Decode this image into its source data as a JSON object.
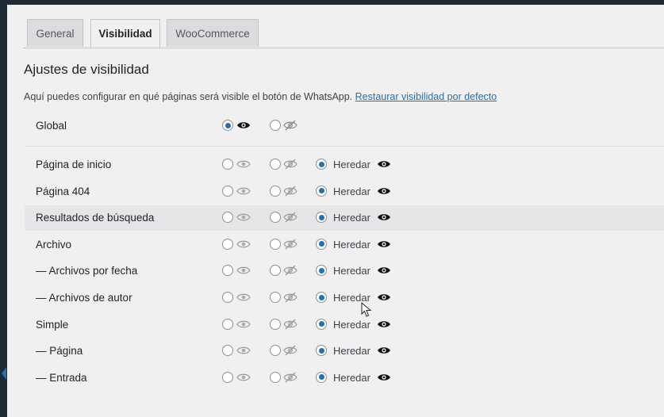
{
  "tabs": [
    {
      "label": "General",
      "active": false
    },
    {
      "label": "Visibilidad",
      "active": true
    },
    {
      "label": "WooCommerce",
      "active": false
    }
  ],
  "section": {
    "title": "Ajustes de visibilidad",
    "description": "Aquí puedes configurar en qué páginas será visible el botón de WhatsApp.",
    "restore_link": "Restaurar visibilidad por defecto"
  },
  "global": {
    "label": "Global",
    "selected": "show"
  },
  "rows": [
    {
      "label": "Página de inicio",
      "inherit": "Heredar",
      "selected": "inherit"
    },
    {
      "label": "Página 404",
      "inherit": "Heredar",
      "selected": "inherit"
    },
    {
      "label": "Resultados de búsqueda",
      "inherit": "Heredar",
      "selected": "inherit"
    },
    {
      "label": "Archivo",
      "inherit": "Heredar",
      "selected": "inherit"
    },
    {
      "label": "— Archivos por fecha",
      "inherit": "Heredar",
      "selected": "inherit"
    },
    {
      "label": "— Archivos de autor",
      "inherit": "Heredar",
      "selected": "inherit"
    },
    {
      "label": "Simple",
      "inherit": "Heredar",
      "selected": "inherit"
    },
    {
      "label": "— Página",
      "inherit": "Heredar",
      "selected": "inherit"
    },
    {
      "label": "— Entrada",
      "inherit": "Heredar",
      "selected": "inherit"
    }
  ],
  "colors": {
    "accent": "#2271b1",
    "background": "#f0f0f1",
    "highlight_row": "#e6e6e8"
  },
  "icons": {
    "show": "eye-icon",
    "hide": "eye-slash-icon",
    "inherit": "eye-icon"
  }
}
